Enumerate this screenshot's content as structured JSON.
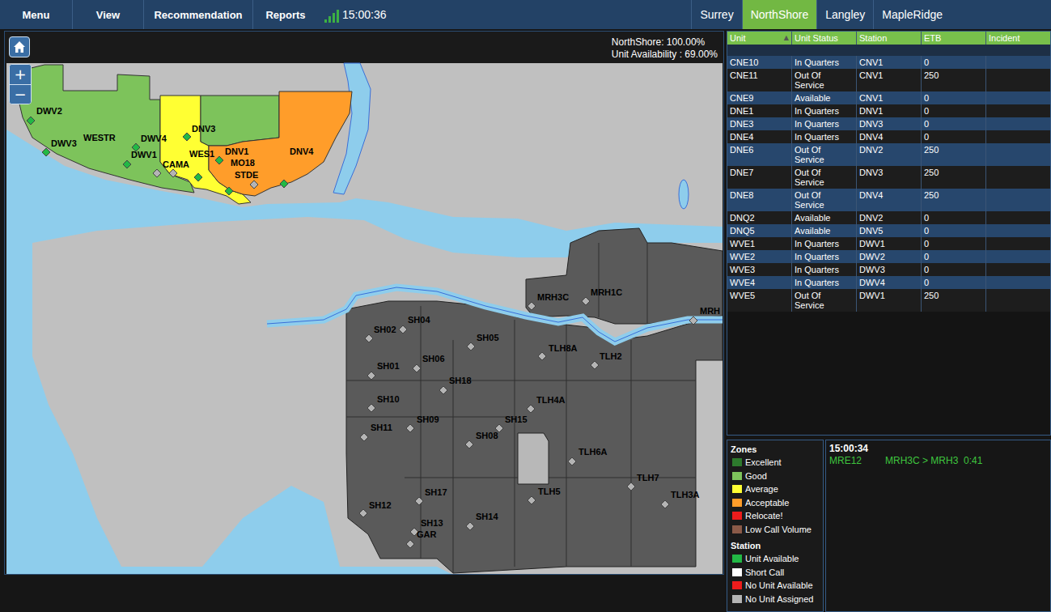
{
  "menu": [
    "Menu",
    "View",
    "Recommendation",
    "Reports"
  ],
  "signal": {
    "level": 1
  },
  "clock": "15:00:36",
  "region_tabs": [
    {
      "label": "Surrey",
      "selected": false
    },
    {
      "label": "NorthShore",
      "selected": true
    },
    {
      "label": "Langley",
      "selected": false
    },
    {
      "label": "MapleRidge",
      "selected": false
    }
  ],
  "map": {
    "summary": [
      "NorthShore: 100.00%",
      "Unit Availability : 69.00%"
    ],
    "zoom_in": "+",
    "zoom_out": "−",
    "zones": [
      {
        "rating": "Good"
      },
      {
        "rating": "Average"
      },
      {
        "rating": "Good"
      },
      {
        "rating": "Acceptable"
      }
    ],
    "stations": [
      {
        "label": "DWV2",
        "status": "Unit Available"
      },
      {
        "label": "DWV3",
        "status": "Unit Available"
      },
      {
        "label": "WESTR",
        "status": "No Unit Assigned"
      },
      {
        "label": "DWV4",
        "status": "Unit Available"
      },
      {
        "label": "DWV1",
        "status": "Unit Available"
      },
      {
        "label": "DNV3",
        "status": "Unit Available"
      },
      {
        "label": "WES1",
        "status": "Unit Available"
      },
      {
        "label": "CAMA",
        "status": "No Unit Assigned"
      },
      {
        "label": "DNV1",
        "status": "Unit Available"
      },
      {
        "label": "MO18",
        "status": "Unit Available"
      },
      {
        "label": "STDE",
        "status": "No Unit Assigned"
      },
      {
        "label": "DNV4",
        "status": "Unit Available"
      },
      {
        "label": "SH02",
        "status": "No Unit Assigned"
      },
      {
        "label": "SH04",
        "status": "No Unit Assigned"
      },
      {
        "label": "SH05",
        "status": "No Unit Assigned"
      },
      {
        "label": "SH01",
        "status": "No Unit Assigned"
      },
      {
        "label": "SH06",
        "status": "No Unit Assigned"
      },
      {
        "label": "SH18",
        "status": "No Unit Assigned"
      },
      {
        "label": "SH10",
        "status": "No Unit Assigned"
      },
      {
        "label": "SH11",
        "status": "No Unit Assigned"
      },
      {
        "label": "SH09",
        "status": "No Unit Assigned"
      },
      {
        "label": "SH15",
        "status": "No Unit Assigned"
      },
      {
        "label": "SH08",
        "status": "No Unit Assigned"
      },
      {
        "label": "SH17",
        "status": "No Unit Assigned"
      },
      {
        "label": "SH12",
        "status": "No Unit Assigned"
      },
      {
        "label": "SH13",
        "status": "No Unit Assigned"
      },
      {
        "label": "GAR",
        "status": "No Unit Assigned"
      },
      {
        "label": "SH14",
        "status": "No Unit Assigned"
      },
      {
        "label": "TLH8A",
        "status": "No Unit Assigned"
      },
      {
        "label": "TLH2",
        "status": "No Unit Assigned"
      },
      {
        "label": "TLH4A",
        "status": "No Unit Assigned"
      },
      {
        "label": "TLH6A",
        "status": "No Unit Assigned"
      },
      {
        "label": "TLH7",
        "status": "No Unit Assigned"
      },
      {
        "label": "TLH3A",
        "status": "No Unit Assigned"
      },
      {
        "label": "TLH5",
        "status": "No Unit Assigned"
      },
      {
        "label": "MRH3C",
        "status": "No Unit Assigned"
      },
      {
        "label": "MRH1C",
        "status": "No Unit Assigned"
      },
      {
        "label": "MRH",
        "status": "No Unit Assigned"
      }
    ]
  },
  "table": {
    "sort_icon": "▲",
    "columns": [
      {
        "label": "Unit",
        "sorted": true
      },
      {
        "label": "Unit Status",
        "sorted": false
      },
      {
        "label": "Station",
        "sorted": false
      },
      {
        "label": "ETB",
        "sorted": false
      },
      {
        "label": "Incident",
        "sorted": false
      }
    ],
    "rows": [
      {
        "unit": "CNE10",
        "status": "In Quarters",
        "station": "CNV1",
        "etb": "0",
        "incident": ""
      },
      {
        "unit": "CNE11",
        "status": "Out Of Service",
        "station": "CNV1",
        "etb": "250",
        "incident": ""
      },
      {
        "unit": "CNE9",
        "status": "Available",
        "station": "CNV1",
        "etb": "0",
        "incident": ""
      },
      {
        "unit": "DNE1",
        "status": "In Quarters",
        "station": "DNV1",
        "etb": "0",
        "incident": ""
      },
      {
        "unit": "DNE3",
        "status": "In Quarters",
        "station": "DNV3",
        "etb": "0",
        "incident": ""
      },
      {
        "unit": "DNE4",
        "status": "In Quarters",
        "station": "DNV4",
        "etb": "0",
        "incident": ""
      },
      {
        "unit": "DNE6",
        "status": "Out Of Service",
        "station": "DNV2",
        "etb": "250",
        "incident": ""
      },
      {
        "unit": "DNE7",
        "status": "Out Of Service",
        "station": "DNV3",
        "etb": "250",
        "incident": ""
      },
      {
        "unit": "DNE8",
        "status": "Out Of Service",
        "station": "DNV4",
        "etb": "250",
        "incident": ""
      },
      {
        "unit": "DNQ2",
        "status": "Available",
        "station": "DNV2",
        "etb": "0",
        "incident": ""
      },
      {
        "unit": "DNQ5",
        "status": "Available",
        "station": "DNV5",
        "etb": "0",
        "incident": ""
      },
      {
        "unit": "WVE1",
        "status": "In Quarters",
        "station": "DWV1",
        "etb": "0",
        "incident": ""
      },
      {
        "unit": "WVE2",
        "status": "In Quarters",
        "station": "DWV2",
        "etb": "0",
        "incident": ""
      },
      {
        "unit": "WVE3",
        "status": "In Quarters",
        "station": "DWV3",
        "etb": "0",
        "incident": ""
      },
      {
        "unit": "WVE4",
        "status": "In Quarters",
        "station": "DWV4",
        "etb": "0",
        "incident": ""
      },
      {
        "unit": "WVE5",
        "status": "Out Of Service",
        "station": "DWV1",
        "etb": "250",
        "incident": ""
      }
    ]
  },
  "legend": {
    "zones_title": "Zones",
    "zones": [
      {
        "label": "Excellent",
        "color": "#2d7a2d"
      },
      {
        "label": "Good",
        "color": "#7dc35b"
      },
      {
        "label": "Average",
        "color": "#ffff33"
      },
      {
        "label": "Acceptable",
        "color": "#ff9d2a"
      },
      {
        "label": "Relocate!",
        "color": "#ee1c1c"
      },
      {
        "label": "Low Call Volume",
        "color": "#8b5a48"
      }
    ],
    "stations_title": "Station",
    "stations": [
      {
        "label": "Unit Available",
        "color": "#22b845"
      },
      {
        "label": "Short Call",
        "color": "#ffffff"
      },
      {
        "label": "No Unit Available",
        "color": "#ee1c1c"
      },
      {
        "label": "No Unit Assigned",
        "color": "#b4b4b4"
      }
    ]
  },
  "log": {
    "time": "15:00:34",
    "entries": [
      {
        "unit": "MRE12",
        "move": "MRH3C > MRH3",
        "duration": "0:41"
      }
    ]
  }
}
